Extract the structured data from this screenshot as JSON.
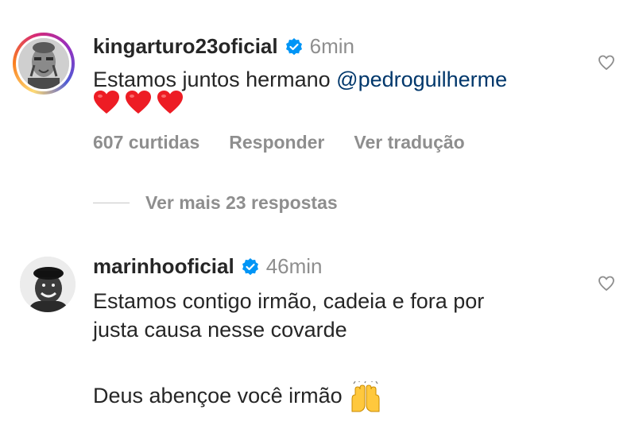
{
  "comments": [
    {
      "username": "kingarturo23oficial",
      "time": "6min",
      "text_prefix": "Estamos juntos hermano ",
      "mention": "@pedroguilherme",
      "hearts": 3,
      "likes": "607 curtidas",
      "reply_label": "Responder",
      "translate_label": "Ver tradução"
    },
    {
      "username": "marinhooficial",
      "time": "46min",
      "line1": "Estamos contigo irmão, cadeia e fora por",
      "line2": "justa causa nesse covarde",
      "line3": "Deus abençoe você irmão"
    }
  ],
  "replies": {
    "view_more_label": "Ver mais 23 respostas"
  },
  "colors": {
    "text": "#262626",
    "secondary": "#8e8e8e",
    "mention": "#00376b",
    "verified": "#0095f6",
    "heart": "#ed1c24"
  },
  "icons": [
    "verified-badge-icon",
    "heart-emoji-icon",
    "like-heart-outline-icon",
    "raising-hands-emoji-icon"
  ]
}
